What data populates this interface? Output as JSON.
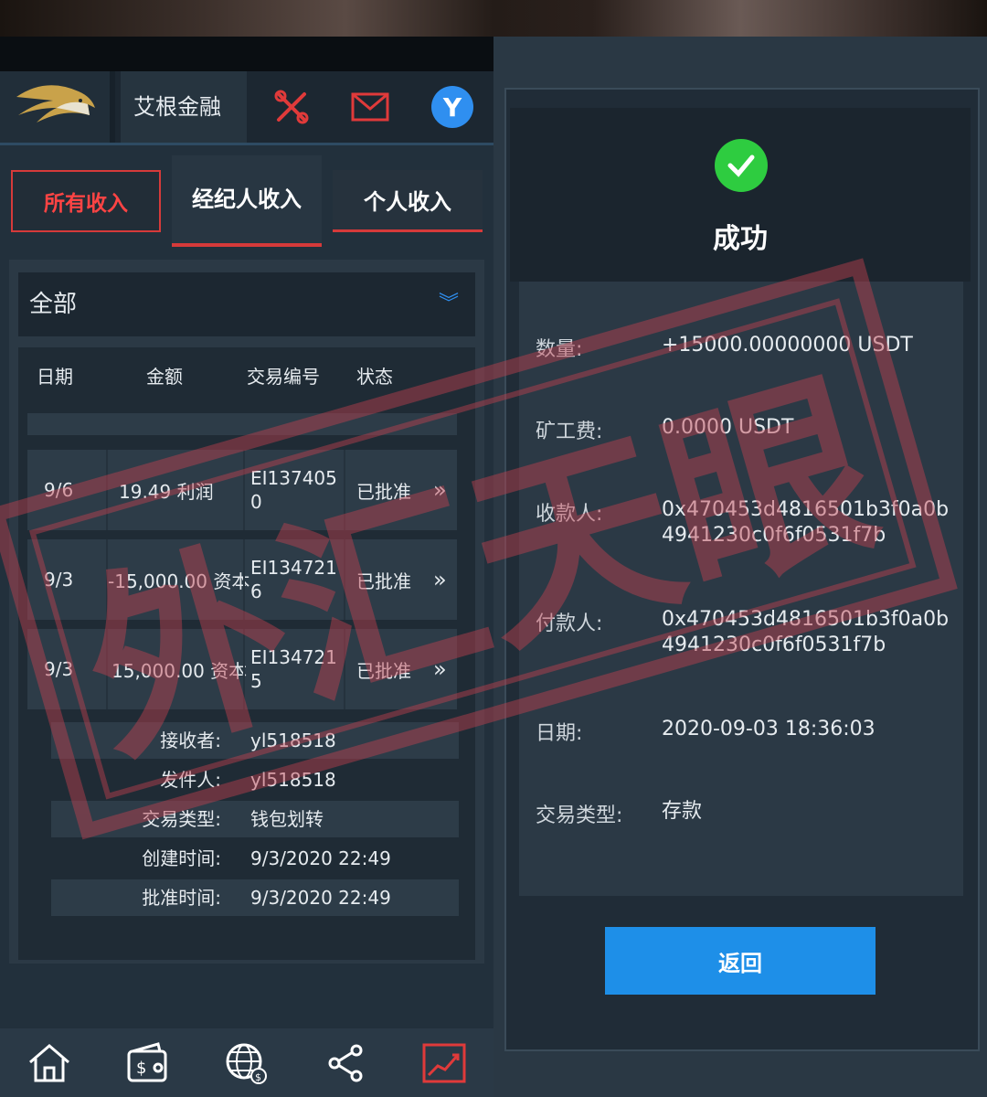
{
  "left_app": {
    "brand": "艾根金融",
    "avatar_letter": "Y",
    "tabs": [
      "所有收入",
      "经纪人收入",
      "个人收入"
    ],
    "filter": {
      "selected": "全部"
    },
    "table": {
      "headers": [
        "日期",
        "金额",
        "交易编号",
        "状态"
      ],
      "rows": [
        {
          "date": "9/6",
          "amount": "19.49 利润",
          "id": "EI1374050",
          "status": "已批准"
        },
        {
          "date": "9/3",
          "amount": "-15,000.00 资本",
          "id": "EI1347216",
          "status": "已批准"
        },
        {
          "date": "9/3",
          "amount": "15,000.00 资本",
          "id": "EI1347215",
          "status": "已批准"
        }
      ],
      "details": [
        {
          "key": "接收者:",
          "value": "yl518518"
        },
        {
          "key": "发件人:",
          "value": "yl518518"
        },
        {
          "key": "交易类型:",
          "value": "钱包划转"
        },
        {
          "key": "创建时间:",
          "value": "9/3/2020 22:49"
        },
        {
          "key": "批准时间:",
          "value": "9/3/2020 22:49"
        }
      ]
    },
    "bottom_nav": [
      "home-icon",
      "wallet-icon",
      "globe-icon",
      "share-icon",
      "chart-icon"
    ],
    "colors": {
      "accent_red": "#d63a3a",
      "accent_blue": "#2f8ff0"
    }
  },
  "right_app": {
    "status": "成功",
    "fields": [
      {
        "key": "数量:",
        "value": "+15000.00000000 USDT"
      },
      {
        "key": "矿工费:",
        "value": "0.0000 USDT"
      },
      {
        "key": "收款人:",
        "value": "0x470453d4816501b3f0a0b4941230c0f6f0531f7b"
      },
      {
        "key": "付款人:",
        "value": "0x470453d4816501b3f0a0b4941230c0f6f0531f7b"
      },
      {
        "key": "日期:",
        "value": "2020-09-03 18:36:03"
      },
      {
        "key": "交易类型:",
        "value": "存款"
      }
    ],
    "return_button": "返回",
    "colors": {
      "success_green": "#2ecc40",
      "button_blue": "#1e8fe8"
    }
  },
  "stamp_text": "外汇天眼"
}
